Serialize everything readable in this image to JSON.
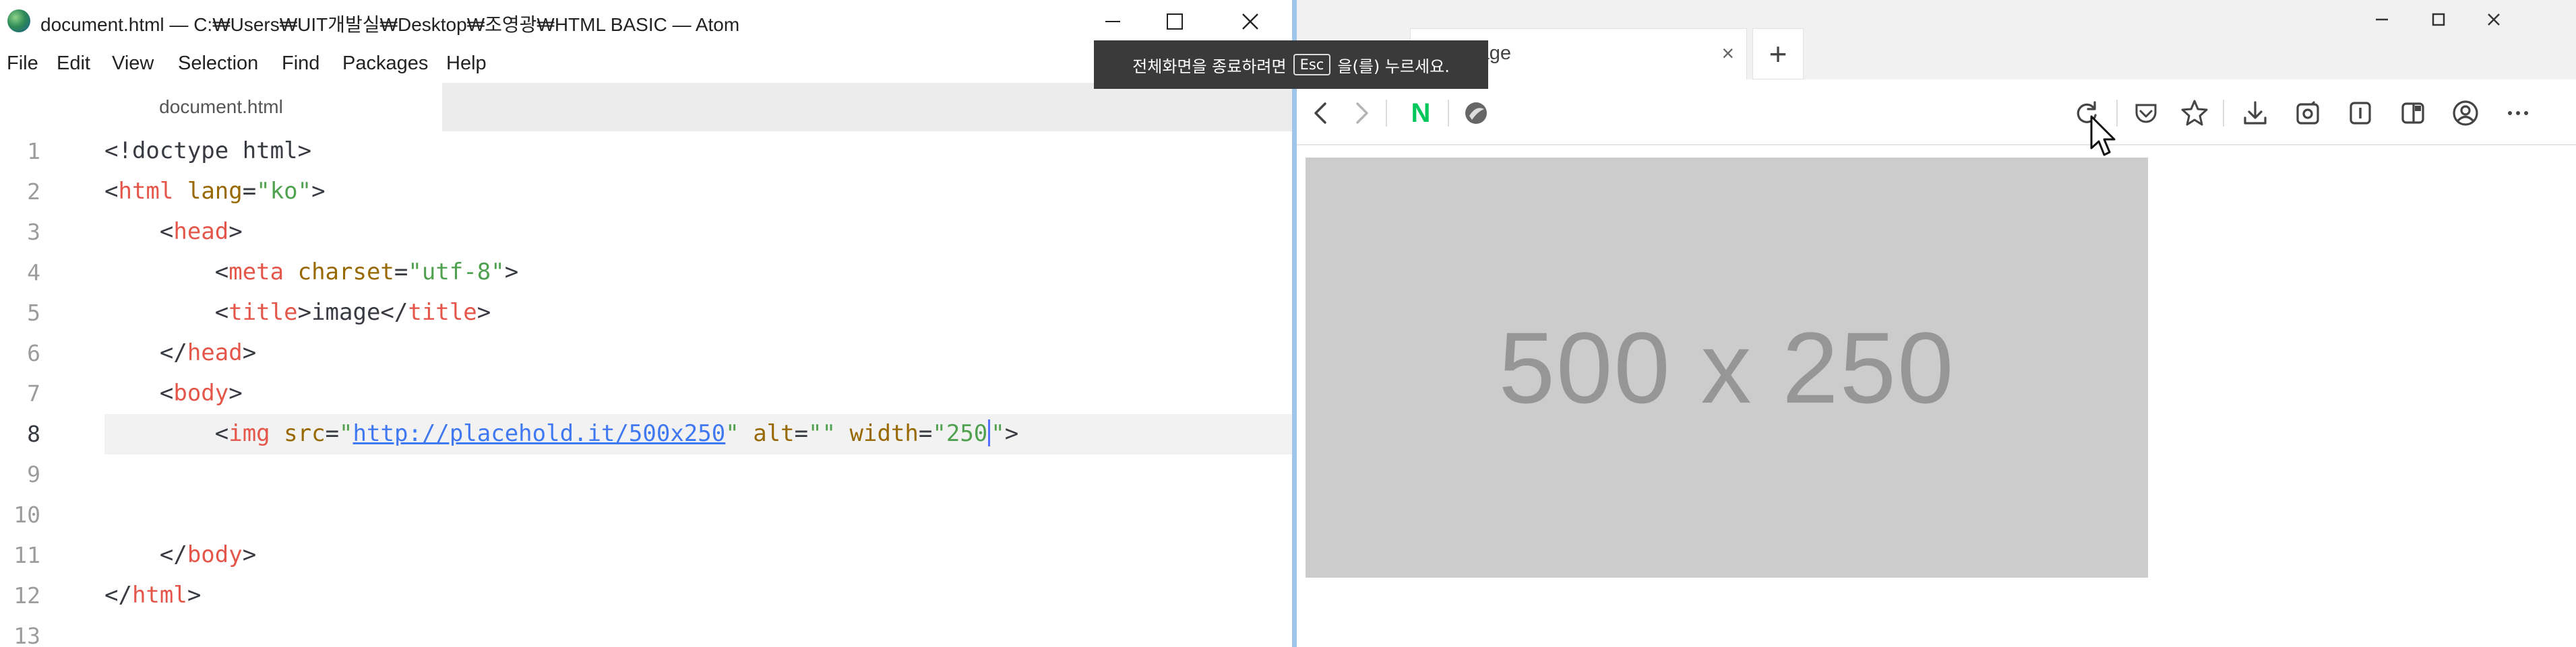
{
  "atom": {
    "window_title": "document.html — C:₩Users₩UIT개발실₩Desktop₩조영광₩HTML BASIC — Atom",
    "menu": [
      "File",
      "Edit",
      "View",
      "Selection",
      "Find",
      "Packages",
      "Help"
    ],
    "tab_label": "document.html",
    "active_line": 8,
    "line_numbers": [
      "1",
      "2",
      "3",
      "4",
      "5",
      "6",
      "7",
      "8",
      "9",
      "10",
      "11",
      "12",
      "13"
    ]
  },
  "fullscreen_tip": {
    "before": "전체화면을 종료하려면",
    "key": "Esc",
    "after": "을(를) 누르세요."
  },
  "browser": {
    "tab_title": "image",
    "tab_close": "×",
    "new_tab": "+",
    "bookmark_naver": "N",
    "placeholder_text": "500 x 250"
  },
  "icons": {
    "atom_logo": "atom-logo-icon",
    "window_controls": [
      "minimize-icon",
      "maximize-icon",
      "close-icon"
    ],
    "nav": [
      "back-icon",
      "forward-icon",
      "reload-icon"
    ],
    "toolbar": [
      "pocket-icon",
      "star-icon",
      "download-icon",
      "screenshot-icon",
      "reader-icon",
      "sidebar-icon",
      "account-icon",
      "more-icon"
    ]
  },
  "colors": {
    "tag": "#e45649",
    "attr": "#986801",
    "string": "#50a14f",
    "url": "#4078f2",
    "placeholder_bg": "#cccccc",
    "placeholder_text": "#969696",
    "naver_green": "#03c75a"
  }
}
